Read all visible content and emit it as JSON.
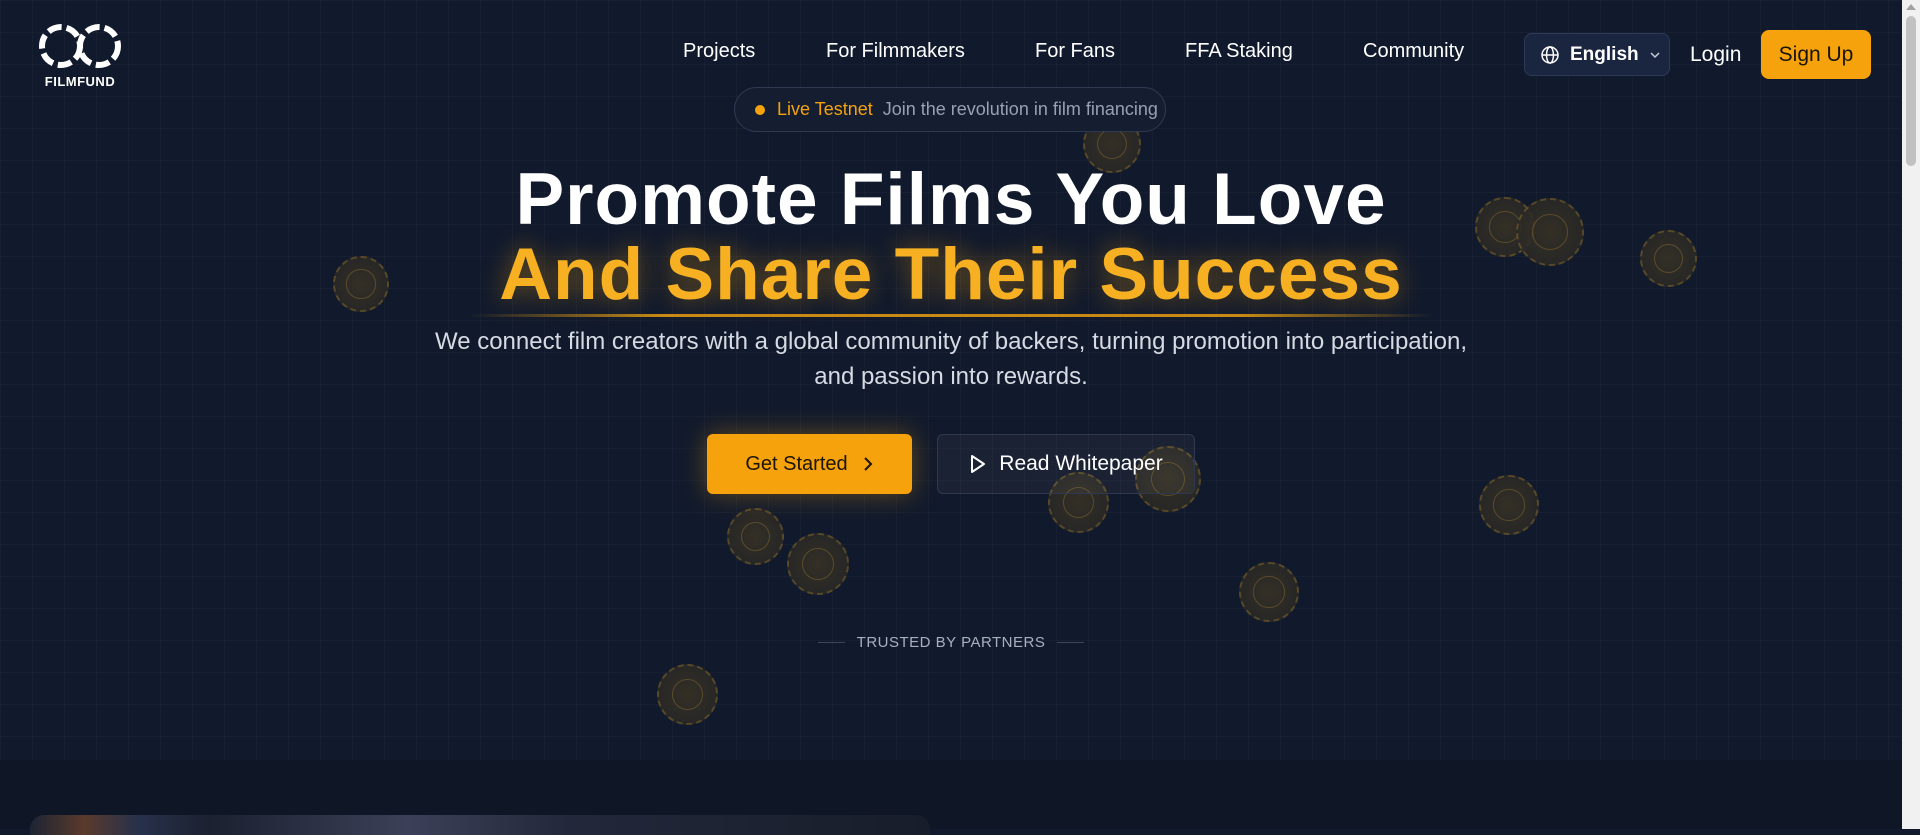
{
  "brand": {
    "name": "FILMFUND",
    "accent": "#f5a20c",
    "background": "#111a2c"
  },
  "nav": {
    "items": [
      {
        "label": "Projects"
      },
      {
        "label": "For Filmmakers"
      },
      {
        "label": "For Fans"
      },
      {
        "label": "FFA Staking"
      },
      {
        "label": "Community"
      }
    ]
  },
  "header": {
    "language": {
      "label": "English",
      "icon": "globe-icon",
      "dropdown_icon": "chevron-down-icon"
    },
    "login_label": "Login",
    "signup_label": "Sign Up"
  },
  "badge": {
    "status": "Live Testnet",
    "text": "Join the revolution in film financing"
  },
  "hero": {
    "title_line1": "Promote Films You Love",
    "title_line2": "And Share Their Success",
    "subtitle_line1": "We connect film creators with a global community of backers, turning promotion into participation,",
    "subtitle_line2": "and passion into rewards.",
    "primary_cta": {
      "label": "Get Started",
      "icon": "chevron-right-icon"
    },
    "secondary_cta": {
      "label": "Read Whitepaper",
      "icon": "play-icon"
    }
  },
  "trusted": {
    "label": "TRUSTED BY PARTNERS"
  }
}
